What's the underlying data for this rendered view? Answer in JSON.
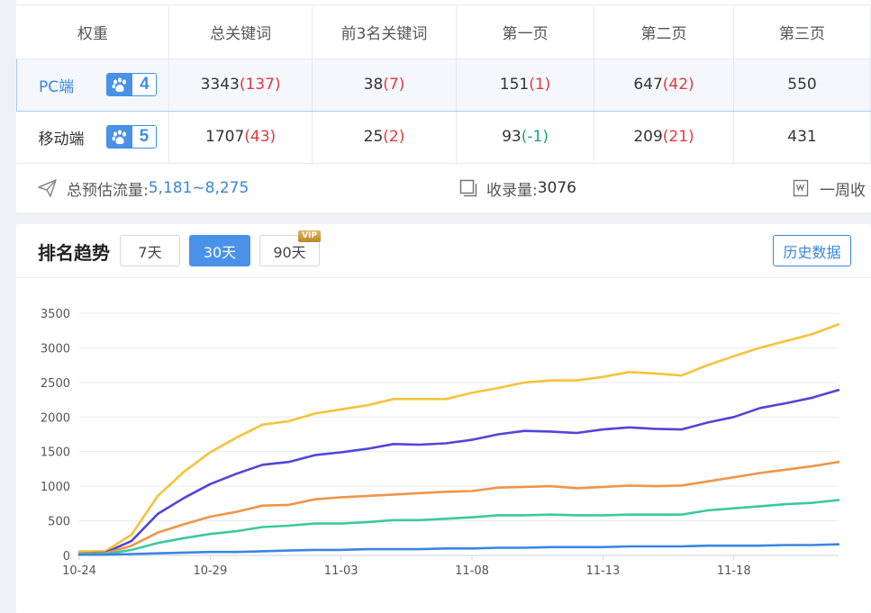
{
  "keyword_table": {
    "headers": [
      "权重",
      "总关键词",
      "前3名关键词",
      "第一页",
      "第二页",
      "第三页"
    ],
    "rows": [
      {
        "label": "PC端",
        "badge": "4",
        "cells": [
          {
            "main": "3343",
            "delta": "(137)",
            "delta_color": "red"
          },
          {
            "main": "38",
            "delta": "(7)",
            "delta_color": "red"
          },
          {
            "main": "151",
            "delta": "(1)",
            "delta_color": "red"
          },
          {
            "main": "647",
            "delta": "(42)",
            "delta_color": "red"
          },
          {
            "main": "550",
            "delta": "",
            "delta_color": "red"
          }
        ]
      },
      {
        "label": "移动端",
        "badge": "5",
        "cells": [
          {
            "main": "1707",
            "delta": "(43)",
            "delta_color": "red"
          },
          {
            "main": "25",
            "delta": "(2)",
            "delta_color": "red"
          },
          {
            "main": "93",
            "delta": "(-1)",
            "delta_color": "green"
          },
          {
            "main": "209",
            "delta": "(21)",
            "delta_color": "red"
          },
          {
            "main": "431",
            "delta": "",
            "delta_color": "red"
          }
        ]
      }
    ]
  },
  "stats": {
    "traffic_label": "总预估流量:",
    "traffic_value": "5,181~8,275",
    "index_label": "收录量:",
    "index_value": "3076",
    "weekly_label": "一周收"
  },
  "trend": {
    "title": "排名趋势",
    "ranges": [
      {
        "label": "7天",
        "active": false,
        "vip": false
      },
      {
        "label": "30天",
        "active": true,
        "vip": false
      },
      {
        "label": "90天",
        "active": false,
        "vip": true
      }
    ],
    "vip_label": "VIP",
    "history_button": "历史数据"
  },
  "colors": {
    "accent": "#4a92e8",
    "red": "#e0393e",
    "green": "#1aa274"
  },
  "chart_data": {
    "type": "line",
    "x_tick_labels": [
      "10-24",
      "10-29",
      "11-03",
      "11-08",
      "11-13",
      "11-18"
    ],
    "x": [
      "10-24",
      "10-25",
      "10-26",
      "10-27",
      "10-28",
      "10-29",
      "10-30",
      "10-31",
      "11-01",
      "11-02",
      "11-03",
      "11-04",
      "11-05",
      "11-06",
      "11-07",
      "11-08",
      "11-09",
      "11-10",
      "11-11",
      "11-12",
      "11-13",
      "11-14",
      "11-15",
      "11-16",
      "11-17",
      "11-18",
      "11-19",
      "11-20",
      "11-21",
      "11-22"
    ],
    "ylim": [
      0,
      3500
    ],
    "yticks": [
      0,
      500,
      1000,
      1500,
      2000,
      2500,
      3000,
      3500
    ],
    "grid": true,
    "series": [
      {
        "color": "#f5c33b",
        "values": [
          60,
          60,
          300,
          860,
          1210,
          1490,
          1700,
          1890,
          1940,
          2050,
          2110,
          2170,
          2260,
          2260,
          2260,
          2350,
          2420,
          2500,
          2530,
          2530,
          2580,
          2650,
          2630,
          2600,
          2750,
          2880,
          3000,
          3100,
          3200,
          3340
        ]
      },
      {
        "color": "#5046d6",
        "values": [
          30,
          40,
          210,
          600,
          830,
          1030,
          1180,
          1310,
          1350,
          1450,
          1490,
          1540,
          1610,
          1600,
          1620,
          1670,
          1750,
          1800,
          1790,
          1770,
          1820,
          1850,
          1830,
          1820,
          1920,
          2000,
          2130,
          2200,
          2280,
          2390
        ]
      },
      {
        "color": "#ef9548",
        "values": [
          30,
          30,
          140,
          330,
          450,
          560,
          630,
          720,
          730,
          810,
          840,
          860,
          880,
          900,
          920,
          930,
          980,
          990,
          1000,
          970,
          990,
          1010,
          1000,
          1010,
          1070,
          1130,
          1190,
          1240,
          1290,
          1350
        ]
      },
      {
        "color": "#3cc8a0",
        "values": [
          20,
          20,
          80,
          180,
          250,
          310,
          350,
          410,
          430,
          460,
          460,
          480,
          510,
          510,
          530,
          550,
          580,
          580,
          590,
          580,
          580,
          590,
          590,
          590,
          650,
          680,
          710,
          740,
          760,
          800
        ]
      },
      {
        "color": "#3a86e0",
        "values": [
          10,
          10,
          20,
          30,
          40,
          50,
          50,
          60,
          70,
          80,
          80,
          90,
          90,
          90,
          100,
          100,
          110,
          110,
          120,
          120,
          120,
          130,
          130,
          130,
          140,
          140,
          140,
          150,
          150,
          160
        ]
      }
    ]
  }
}
